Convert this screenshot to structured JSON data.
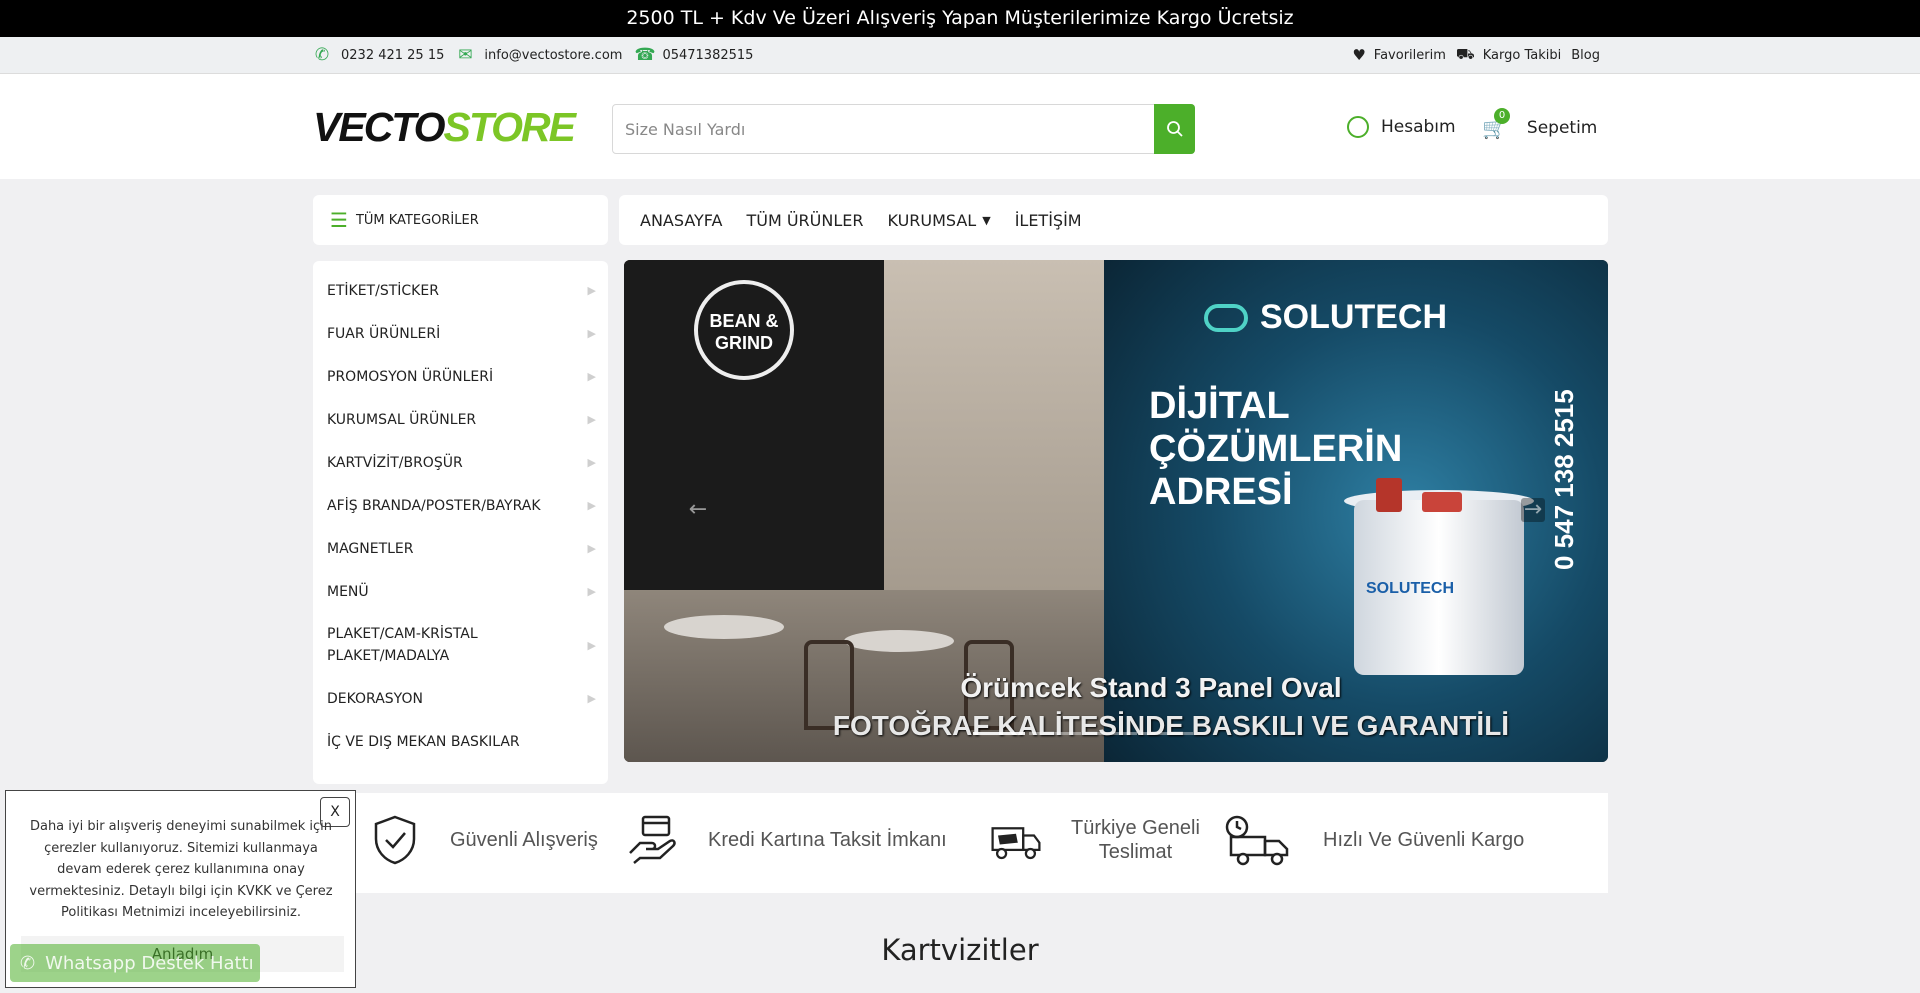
{
  "promo": {
    "text": "2500 TL + Kdv Ve Üzeri Alışveriş Yapan Müşterilerimize Kargo Ücretsiz"
  },
  "topbar": {
    "phone": "0232 421 25 15",
    "email": "info@vectostore.com",
    "whatsapp": "05471382515",
    "favorites": "Favorilerim",
    "tracking": "Kargo Takibi",
    "blog": "Blog"
  },
  "header": {
    "logo_part1": "VECTO",
    "logo_part2": "STORE",
    "search_placeholder": "Size Nasıl Yardı",
    "account_label": "Hesabım",
    "cart_label": "Sepetim",
    "cart_count": "0"
  },
  "categories_toggle": "TÜM KATEGORİLER",
  "nav": {
    "items": [
      "ANASAYFA",
      "TÜM ÜRÜNLER",
      "KURUMSAL",
      "İLETİŞİM"
    ]
  },
  "categories": [
    "ETİKET/STİCKER",
    "FUAR ÜRÜNLERİ",
    "PROMOSYON ÜRÜNLERİ",
    "KURUMSAL ÜRÜNLER",
    "KARTVİZİT/BROŞÜR",
    "AFİŞ BRANDA/POSTER/BAYRAK",
    "MAGNETLER",
    "MENÜ",
    "PLAKET/CAM-KRİSTAL PLAKET/MADALYA",
    "DEKORASYON",
    "İÇ VE DIŞ MEKAN BASKILAR"
  ],
  "banner": {
    "badge_text": "BEAN & GRIND",
    "brand": "SOLUTECH",
    "heading_lines": [
      "DİJİTAL",
      "ÇÖZÜMLERİN",
      "ADRESİ"
    ],
    "phone": "0 547 138 2515",
    "podium_brand": "SOLUTECH",
    "caption1": "Örümcek Stand 3 Panel Oval",
    "caption2": "FOTOĞRAF KALİTESİNDE BASKILI VE GARANTİLİ"
  },
  "features": [
    {
      "label": "Güvenli Alışveriş",
      "icon": "shield-check-icon"
    },
    {
      "label": "Kredi Kartına Taksit İmkanı",
      "icon": "credit-card-hand-icon"
    },
    {
      "label": "Türkiye Geneli Teslimat",
      "label_line1": "Türkiye Geneli",
      "label_line2": "Teslimat",
      "icon": "delivery-truck-icon"
    },
    {
      "label": "Hızlı Ve Güvenli Kargo",
      "icon": "fast-truck-icon"
    }
  ],
  "section_title": "Kartvizitler",
  "cookie": {
    "text": "Daha iyi bir alışveriş deneyimi sunabilmek için çerezler kullanıyoruz. Sitemizi kullanmaya devam ederek çerez kullanımına onay vermektesiniz. Detaylı bilgi için KVKK ve Çerez Politikası Metnimizi inceleyebilirsiniz.",
    "close": "X",
    "accept": "Anladım"
  },
  "whatsapp_float": "Whatsapp Destek Hattı",
  "colors": {
    "accent": "#4caf2a",
    "brand_green": "#7cc626",
    "promo_bg": "#000000"
  }
}
